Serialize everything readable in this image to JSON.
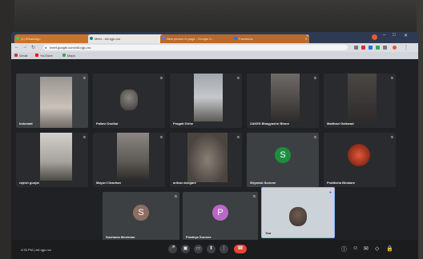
{
  "browser": {
    "tabs": [
      {
        "label": "(1) WhatsApp",
        "color": "#25d366"
      },
      {
        "label": "Meet - xkf-rgjc-rzs",
        "color": "#00897b"
      },
      {
        "label": "New person in page - Google D...",
        "color": "#4285f4"
      },
      {
        "label": "Facebook",
        "color": "#1877f2"
      }
    ],
    "new_tab": "+",
    "url": "meet.google.com/xkf-rgjc-rzs",
    "bookmarks": [
      {
        "label": "Gmail",
        "color": "#d93025"
      },
      {
        "label": "YouTube",
        "color": "#ff0000"
      },
      {
        "label": "Maps",
        "color": "#34a853"
      }
    ]
  },
  "meet": {
    "participants": [
      {
        "name": "Indumati",
        "avatar": "",
        "color": ""
      },
      {
        "name": "Pallavi Dudhal",
        "avatar": "",
        "color": ""
      },
      {
        "name": "Pragati Girhe",
        "avatar": "",
        "color": ""
      },
      {
        "name": "ZAKES Bhagyashri Bhore",
        "avatar": "",
        "color": ""
      },
      {
        "name": "Madhavi Gaikwad",
        "avatar": "",
        "color": ""
      },
      {
        "name": "rajesh gunjal",
        "avatar": "",
        "color": ""
      },
      {
        "name": "Mayuri Chavhan",
        "avatar": "",
        "color": ""
      },
      {
        "name": "arihan dongare",
        "avatar": "",
        "color": ""
      },
      {
        "name": "Shyamal Sonone",
        "avatar": "S",
        "color": "#1e8e3e"
      },
      {
        "name": "Pratiksha Bhokare",
        "avatar": "",
        "color": ""
      },
      {
        "name": "Sushama Meshram",
        "avatar": "S",
        "color": "#8d6e63"
      },
      {
        "name": "Pradnya Sonone",
        "avatar": "P",
        "color": "#b968c7"
      },
      {
        "name": "You",
        "avatar": "",
        "color": ""
      }
    ],
    "clock": "4:33 PM  |  xkf-rgjc-rzs",
    "controls": [
      "mic-icon",
      "camera-icon",
      "captions-icon",
      "present-icon",
      "more-icon",
      "end-call-icon"
    ]
  }
}
